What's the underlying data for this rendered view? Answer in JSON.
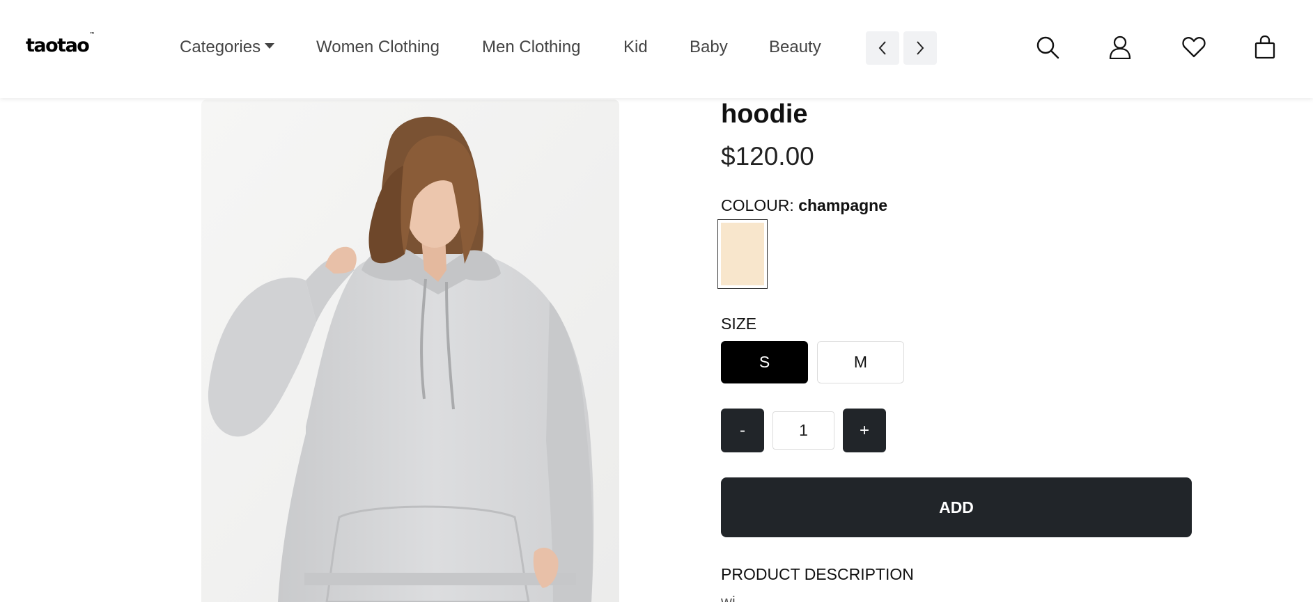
{
  "header": {
    "logo": "taotao",
    "logo_mark": "™",
    "nav": [
      {
        "label": "Categories",
        "has_caret": true
      },
      {
        "label": "Women Clothing"
      },
      {
        "label": "Men Clothing"
      },
      {
        "label": "Kid"
      },
      {
        "label": "Baby"
      },
      {
        "label": "Beauty"
      }
    ],
    "icons": [
      "chevron-left-icon",
      "chevron-right-icon",
      "search-icon",
      "user-icon",
      "heart-icon",
      "shopping-bag-icon"
    ]
  },
  "product": {
    "title": "hoodie",
    "price": "$120.00",
    "colour_label": "COLOUR:",
    "colour_value": "champagne",
    "swatch_color": "#f8e6cc",
    "size_label": "SIZE",
    "sizes": [
      {
        "label": "S",
        "selected": true
      },
      {
        "label": "M",
        "selected": false
      }
    ],
    "quantity": {
      "minus": "-",
      "value": "1",
      "plus": "+"
    },
    "add_label": "ADD",
    "description_label": "PRODUCT DESCRIPTION",
    "description_text": "wi"
  },
  "colors": {
    "dark_button": "#212529",
    "selected_size": "#000000",
    "photo_background": "#f2f2f1",
    "hoodie": "#d6d7d9"
  }
}
